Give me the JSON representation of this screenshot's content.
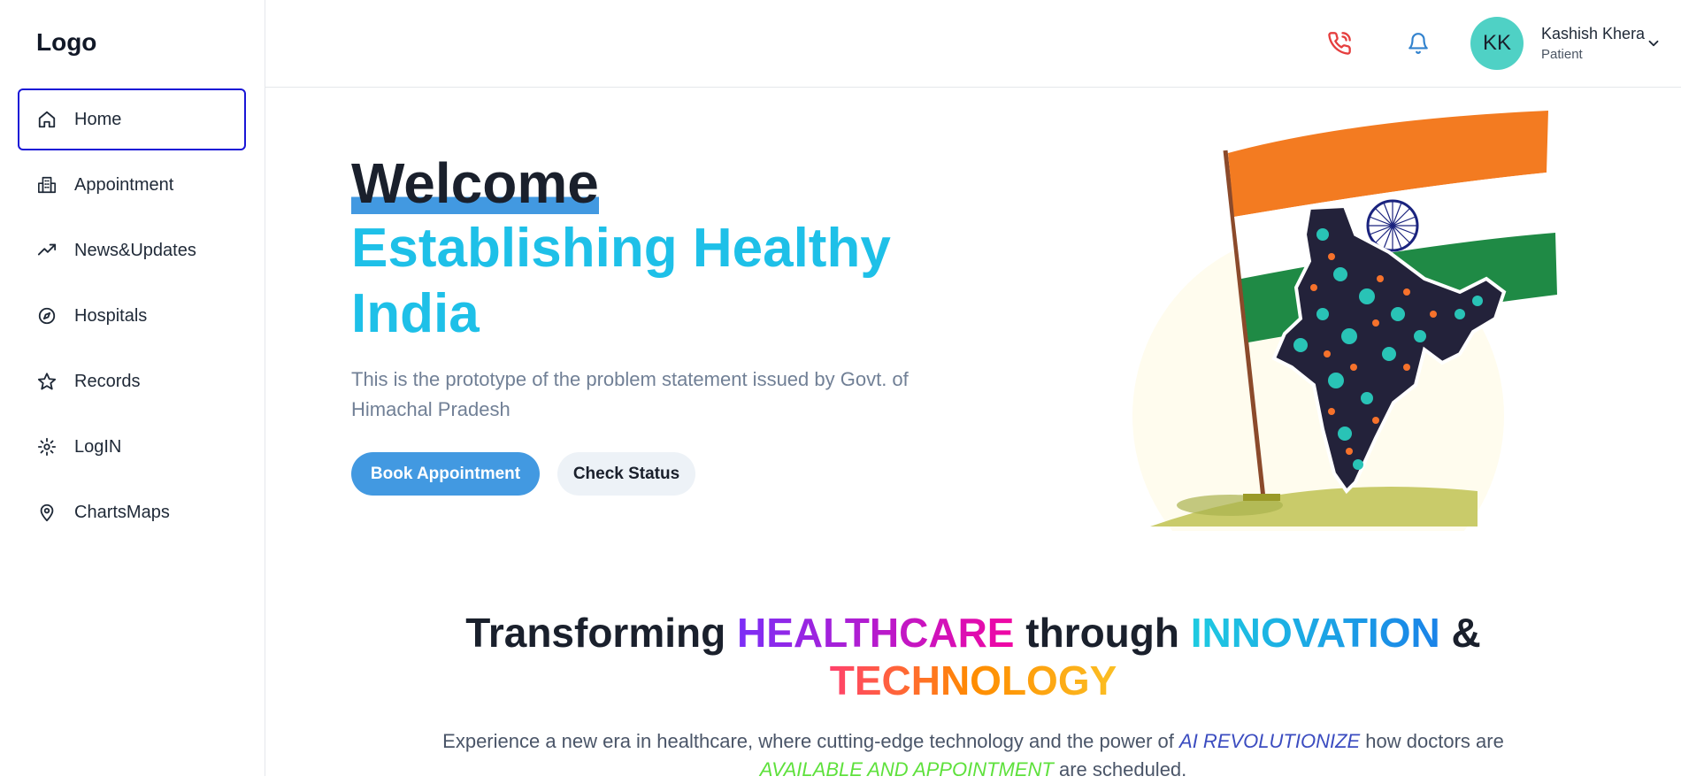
{
  "sidebar": {
    "logo": "Logo",
    "items": [
      {
        "label": "Home",
        "icon": "home-icon",
        "active": true
      },
      {
        "label": "Appointment",
        "icon": "building-icon",
        "active": false
      },
      {
        "label": "News&Updates",
        "icon": "trending-up-icon",
        "active": false
      },
      {
        "label": "Hospitals",
        "icon": "compass-icon",
        "active": false
      },
      {
        "label": "Records",
        "icon": "star-icon",
        "active": false
      },
      {
        "label": "LogIN",
        "icon": "settings-icon",
        "active": false
      },
      {
        "label": "ChartsMaps",
        "icon": "map-pin-icon",
        "active": false
      }
    ]
  },
  "topbar": {
    "avatar_initials": "KK",
    "user_name": "Kashish Khera",
    "user_role": "Patient",
    "accent_avatar": "#4fd1c5"
  },
  "hero": {
    "welcome": "Welcome",
    "title": "Establishing Healthy India",
    "description": "This is the prototype of the problem statement issued by Govt. of Himachal Pradesh",
    "primary_button": "Book Appointment",
    "secondary_button": "Check Status"
  },
  "section": {
    "heading_part1": "Transforming ",
    "heading_hl1": "HEALTHCARE",
    "heading_part2": " through ",
    "heading_hl2": "INNOVATION",
    "heading_part3": " &",
    "heading_hl3": "TECHNOLOGY",
    "text_part1": "Experience a new era in healthcare, where cutting-edge technology and the power of ",
    "text_em1": "AI REVOLUTIONIZE",
    "text_part2": " how doctors are ",
    "text_em2": "AVAILABLE AND APPOINTMENT",
    "text_part3": " are scheduled."
  },
  "colors": {
    "active_border": "#1a16d6",
    "primary": "#4299e1",
    "hero_cyan": "#1ec0e8"
  }
}
